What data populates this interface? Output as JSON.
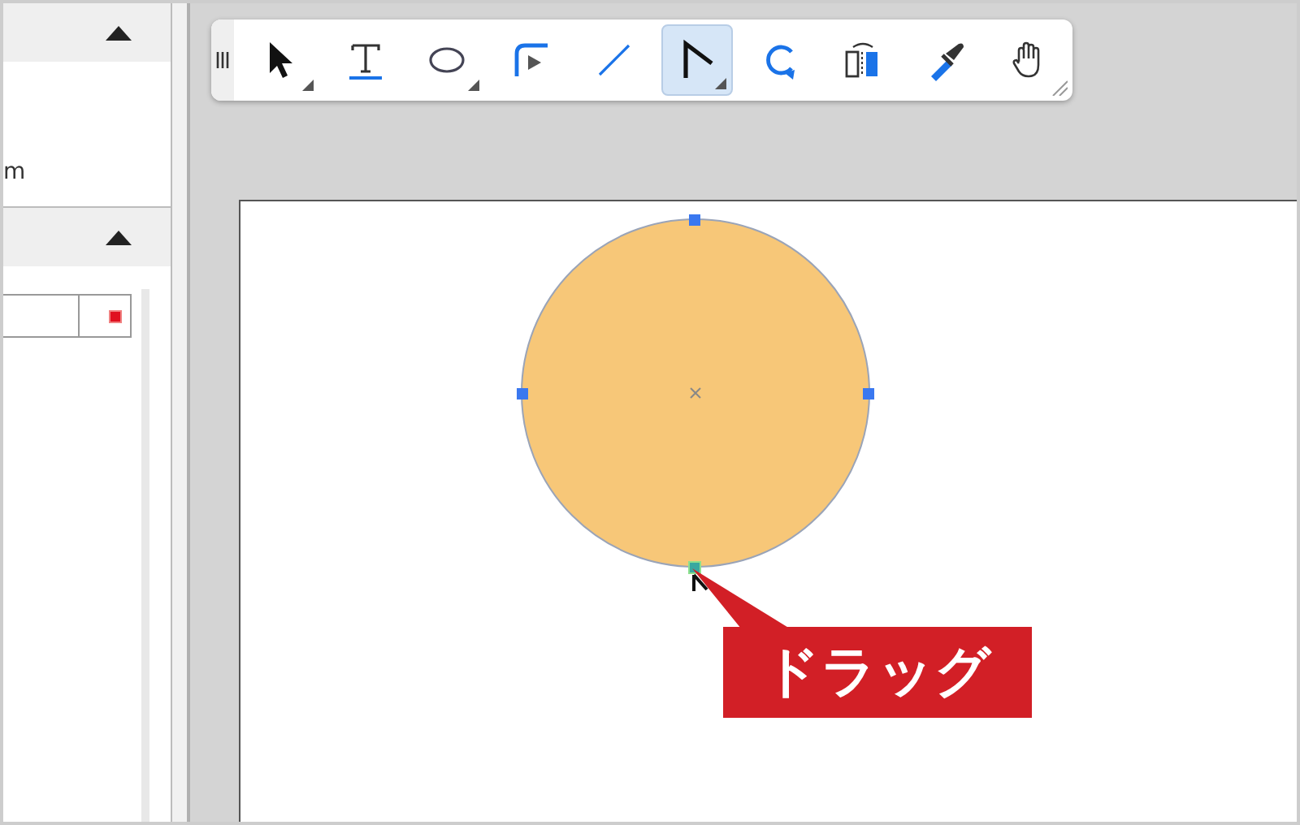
{
  "left_panel": {
    "sections": [
      {
        "expanded": true,
        "body_text": "m"
      },
      {
        "expanded": true
      }
    ]
  },
  "toolbar": {
    "tools": [
      {
        "kind": "pointer",
        "selected": false,
        "submenu": true
      },
      {
        "kind": "text",
        "selected": false,
        "submenu": false
      },
      {
        "kind": "ellipse",
        "selected": false,
        "submenu": true
      },
      {
        "kind": "corner",
        "selected": false,
        "submenu": false
      },
      {
        "kind": "line",
        "selected": false,
        "submenu": false
      },
      {
        "kind": "polyline",
        "selected": true,
        "submenu": true
      },
      {
        "kind": "rotate",
        "selected": false,
        "submenu": false
      },
      {
        "kind": "flip",
        "selected": false,
        "submenu": false
      },
      {
        "kind": "dropper",
        "selected": false,
        "submenu": false
      },
      {
        "kind": "hand",
        "selected": false,
        "submenu": false
      }
    ]
  },
  "callout": {
    "text": "ドラッグ"
  }
}
